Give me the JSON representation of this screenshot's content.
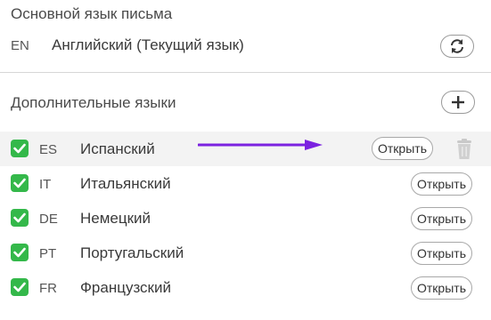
{
  "primary": {
    "title": "Основной язык письма",
    "code": "EN",
    "name": "Английский (Текущий язык)",
    "change_icon": "refresh-icon"
  },
  "additional": {
    "title": "Дополнительные языки",
    "add_icon": "plus-icon",
    "items": [
      {
        "code": "ES",
        "name": "Испанский",
        "open_label": "Открыть",
        "checked": true
      },
      {
        "code": "IT",
        "name": "Итальянский",
        "open_label": "Открыть",
        "checked": true
      },
      {
        "code": "DE",
        "name": "Немецкий",
        "open_label": "Открыть",
        "checked": true
      },
      {
        "code": "PT",
        "name": "Португальский",
        "open_label": "Открыть",
        "checked": true
      },
      {
        "code": "FR",
        "name": "Французский",
        "open_label": "Открыть",
        "checked": true
      }
    ]
  },
  "colors": {
    "checkbox": "#34b84a",
    "arrow": "#7b22e0",
    "highlight_row": "#f3f3f3"
  }
}
